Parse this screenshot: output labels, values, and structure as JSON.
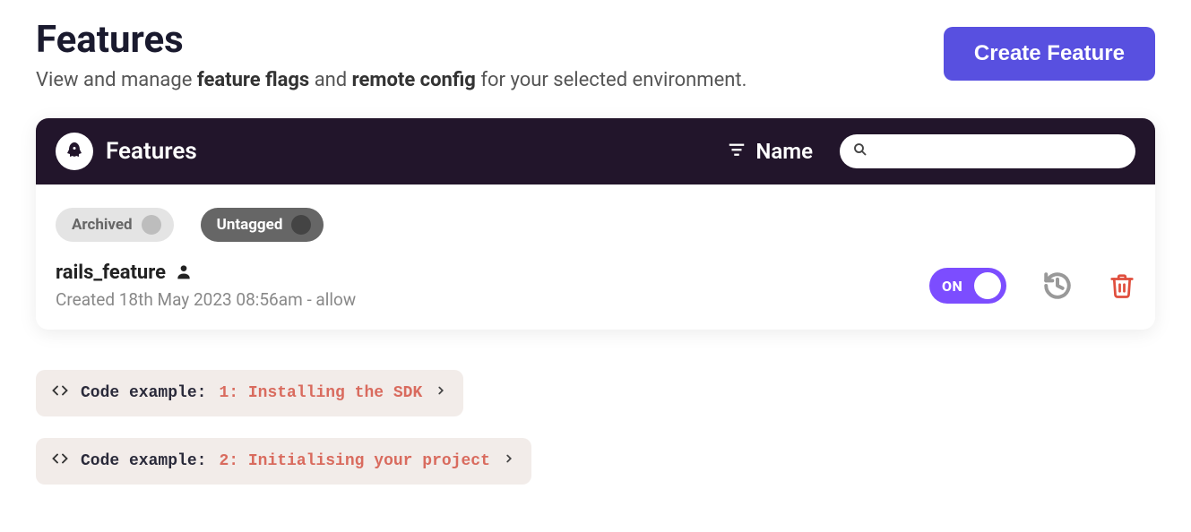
{
  "page": {
    "title": "Features",
    "subtitle_pre": "View and manage ",
    "subtitle_b1": "feature flags",
    "subtitle_mid": " and ",
    "subtitle_b2": "remote config",
    "subtitle_post": " for your selected environment."
  },
  "actions": {
    "create_label": "Create Feature"
  },
  "panel": {
    "title": "Features",
    "sort_label": "Name",
    "search_value": ""
  },
  "filters": {
    "archived_label": "Archived",
    "untagged_label": "Untagged"
  },
  "feature": {
    "name": "rails_feature",
    "meta": "Created 18th May 2023 08:56am - allow",
    "toggle_label": "ON"
  },
  "code_examples": {
    "prefix": "Code example:",
    "items": [
      "1: Installing the SDK",
      "2: Initialising your project"
    ]
  }
}
